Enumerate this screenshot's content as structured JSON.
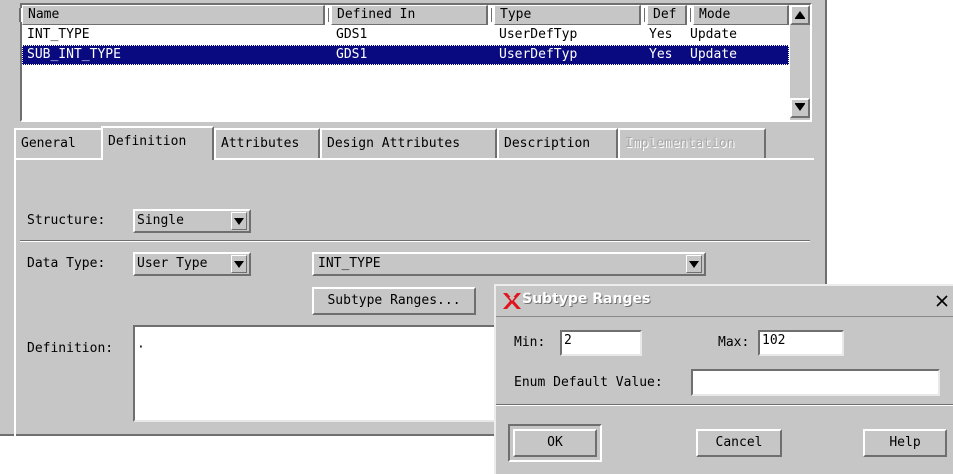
{
  "table": {
    "columns": [
      "Name",
      "Defined In",
      "Type",
      "Def",
      "Mode"
    ],
    "rows": [
      {
        "name": "INT_TYPE",
        "defined_in": "GDS1",
        "type": "UserDefTyp",
        "def": "Yes",
        "mode": "Update"
      },
      {
        "name": "SUB_INT_TYPE",
        "defined_in": "GDS1",
        "type": "UserDefTyp",
        "def": "Yes",
        "mode": "Update",
        "selected": true
      }
    ]
  },
  "tabs": [
    {
      "label": "General"
    },
    {
      "label": "Definition",
      "active": true
    },
    {
      "label": "Attributes"
    },
    {
      "label": "Design Attributes"
    },
    {
      "label": "Description"
    },
    {
      "label": "Implementation",
      "disabled": true
    }
  ],
  "form": {
    "structure_label": "Structure:",
    "structure_value": "Single",
    "data_type_label": "Data Type:",
    "data_type_value": "User Type",
    "type_name_value": "INT_TYPE",
    "subtype_ranges_button": "Subtype Ranges...",
    "definition_label": "Definition:",
    "definition_value": "·"
  },
  "dialog": {
    "title": "Subtype Ranges",
    "min_label": "Min:",
    "min_value": "2",
    "max_label": "Max:",
    "max_value": "102",
    "enum_label": "Enum Default Value:",
    "enum_value": "",
    "ok_label": "OK",
    "cancel_label": "Cancel",
    "help_label": "Help",
    "close_glyph": "×"
  },
  "icons": {
    "scroll_up": "scroll-up-arrow-icon",
    "scroll_down": "scroll-down-arrow-icon",
    "combo_arrow": "dropdown-arrow-icon",
    "app": "x-logo-icon",
    "close": "close-icon"
  },
  "colors": {
    "window_bg": "#c6c6c6",
    "selection_bg": "#0a0a80",
    "selection_fg": "#ffffff",
    "logo_red": "#e0141c"
  }
}
